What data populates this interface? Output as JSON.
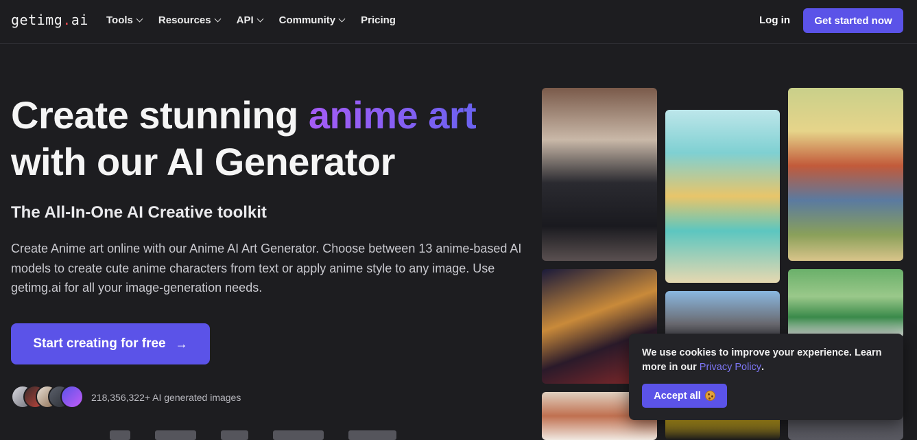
{
  "nav": {
    "logo": {
      "text_before_dot": "getimg",
      "dot": ".",
      "text_after_dot": "ai"
    },
    "menu": [
      {
        "label": "Tools",
        "has_dropdown": true
      },
      {
        "label": "Resources",
        "has_dropdown": true
      },
      {
        "label": "API",
        "has_dropdown": true
      },
      {
        "label": "Community",
        "has_dropdown": true
      },
      {
        "label": "Pricing",
        "has_dropdown": false
      }
    ],
    "login_label": "Log in",
    "cta_label": "Get started now"
  },
  "hero": {
    "title_part1": "Create stunning ",
    "title_highlight": "anime art",
    "title_part2": "with our AI Generator",
    "subtitle": "The All-In-One AI Creative toolkit",
    "description": "Create Anime art online with our Anime AI Art Generator. Choose between 13 anime-based AI models to create cute anime characters from text or apply anime style to any image. Use getimg.ai for all your image-generation needs.",
    "cta_label": "Start creating for free",
    "cta_icon": "arrow-right-icon",
    "count_text": "218,356,322+ AI generated images"
  },
  "gallery": {
    "images": [
      "anime girl with beret in city street",
      "anime girl jumping on beach",
      "anime boy sitting in park",
      "anime girl at night city rooftop",
      "anime girl with stadium background",
      "anime friends in green park",
      "anime girl in store aisle",
      "anime character in yellow",
      "anime scene partial"
    ]
  },
  "cookie": {
    "text_before_link": "We use cookies to improve your experience. Learn more in our ",
    "link_label": "Privacy Policy",
    "text_after_link": ".",
    "accept_label": "Accept all",
    "accept_icon": "cookie-icon"
  },
  "colors": {
    "background": "#1d1d20",
    "accent": "#5b53e8",
    "gradient_start": "#a55cf6",
    "gradient_end": "#6b62f0"
  }
}
